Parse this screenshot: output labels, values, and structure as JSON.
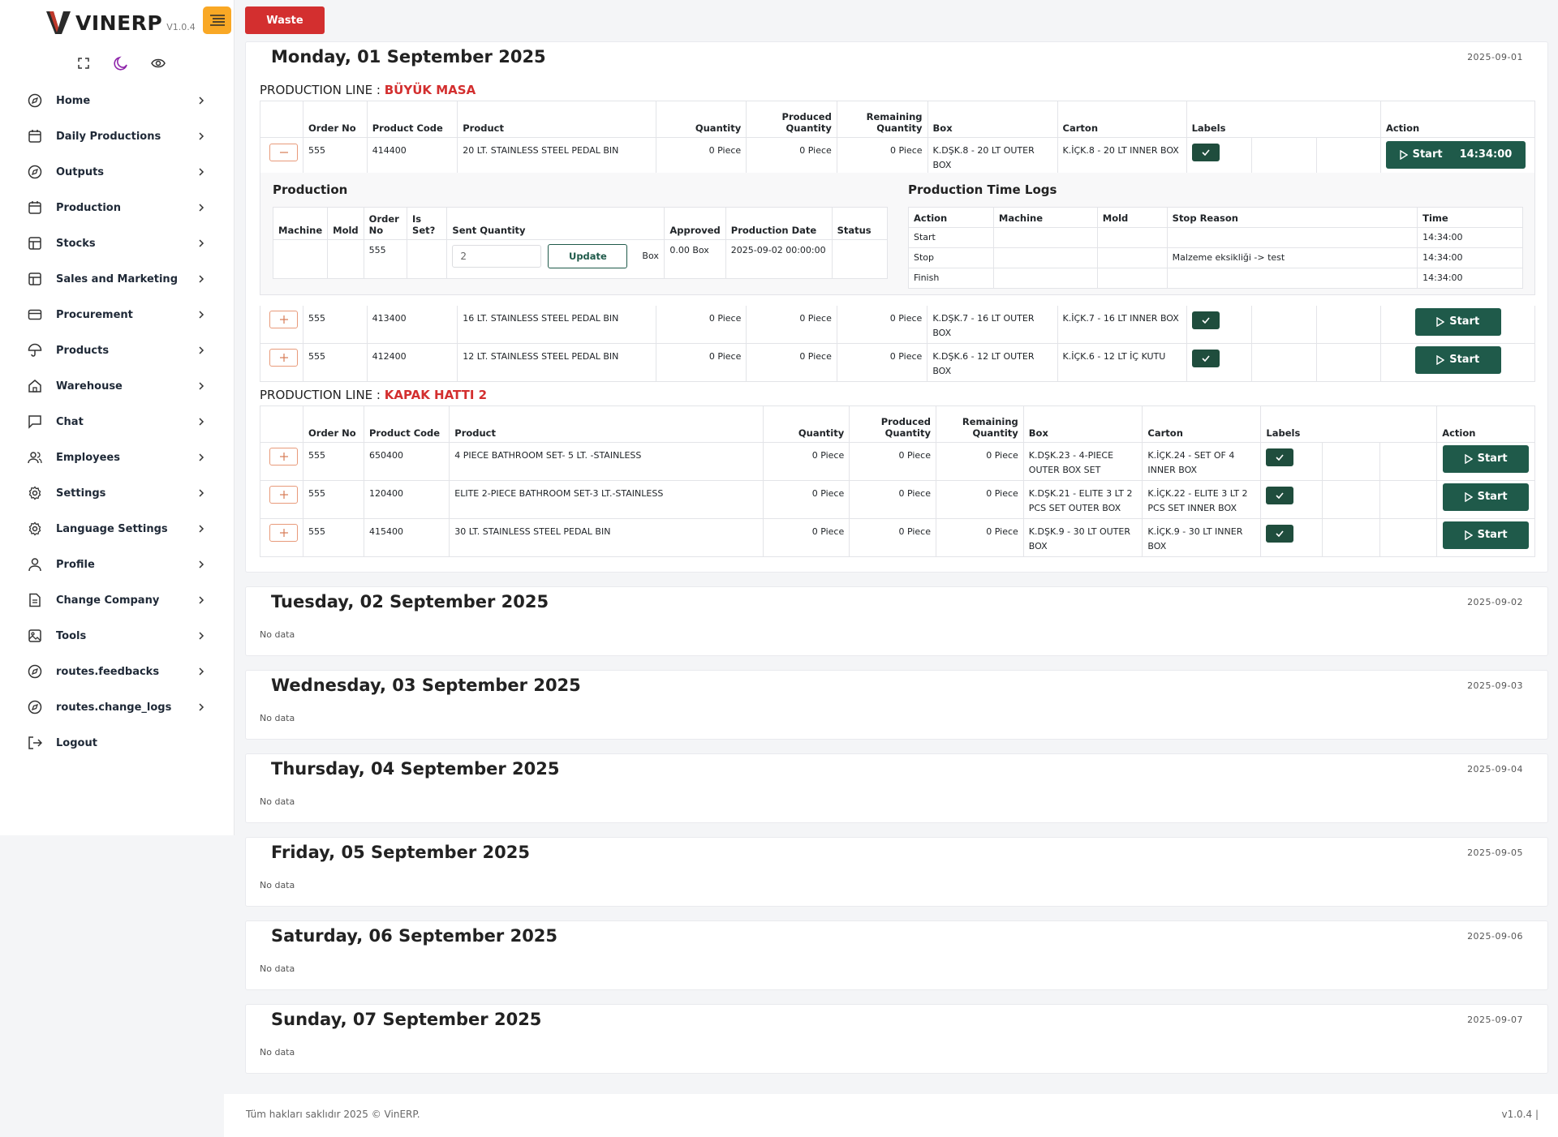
{
  "app": {
    "name": "VINERP",
    "version": "V1.0.4"
  },
  "sidebar": {
    "items": [
      {
        "label": "Home",
        "icon": "compass-icon",
        "chevron": true
      },
      {
        "label": "Daily Productions",
        "icon": "calendar-icon",
        "chevron": true
      },
      {
        "label": "Outputs",
        "icon": "compass-icon",
        "chevron": true
      },
      {
        "label": "Production",
        "icon": "calendar-icon",
        "chevron": true
      },
      {
        "label": "Stocks",
        "icon": "table-icon",
        "chevron": true
      },
      {
        "label": "Sales and Marketing",
        "icon": "table-icon",
        "chevron": true
      },
      {
        "label": "Procurement",
        "icon": "card-icon",
        "chevron": true
      },
      {
        "label": "Products",
        "icon": "umbrella-icon",
        "chevron": true
      },
      {
        "label": "Warehouse",
        "icon": "home-icon",
        "chevron": true
      },
      {
        "label": "Chat",
        "icon": "chat-icon",
        "chevron": true
      },
      {
        "label": "Employees",
        "icon": "users-icon",
        "chevron": true
      },
      {
        "label": "Settings",
        "icon": "gear-icon",
        "chevron": true
      },
      {
        "label": "Language Settings",
        "icon": "gear-icon",
        "chevron": true
      },
      {
        "label": "Profile",
        "icon": "user-icon",
        "chevron": true
      },
      {
        "label": "Change Company",
        "icon": "document-icon",
        "chevron": true
      },
      {
        "label": "Tools",
        "icon": "image-icon",
        "chevron": true
      },
      {
        "label": "routes.feedbacks",
        "icon": "compass-icon",
        "chevron": true
      },
      {
        "label": "routes.change_logs",
        "icon": "compass-icon",
        "chevron": true
      },
      {
        "label": "Logout",
        "icon": "logout-icon",
        "chevron": false
      }
    ]
  },
  "toolbar": {
    "waste_label": "Waste"
  },
  "days": [
    {
      "title": "Monday, 01 September 2025",
      "date": "2025-09-01"
    },
    {
      "title": "Tuesday, 02 September 2025",
      "date": "2025-09-02",
      "nodata": "No data"
    },
    {
      "title": "Wednesday, 03 September 2025",
      "date": "2025-09-03",
      "nodata": "No data"
    },
    {
      "title": "Thursday, 04 September 2025",
      "date": "2025-09-04",
      "nodata": "No data"
    },
    {
      "title": "Friday, 05 September 2025",
      "date": "2025-09-05",
      "nodata": "No data"
    },
    {
      "title": "Saturday, 06 September 2025",
      "date": "2025-09-06",
      "nodata": "No data"
    },
    {
      "title": "Sunday, 07 September 2025",
      "date": "2025-09-07",
      "nodata": "No data"
    }
  ],
  "line_prefix": "PRODUCTION LINE : ",
  "columns": {
    "order_no": "Order No",
    "product_code": "Product Code",
    "product": "Product",
    "quantity": "Quantity",
    "produced_1": "Produced",
    "produced_2": "Quantity",
    "remaining_1": "Remaining",
    "remaining_2": "Quantity",
    "box": "Box",
    "carton": "Carton",
    "labels": "Labels",
    "action": "Action"
  },
  "lines": [
    {
      "name": "BÜYÜK MASA",
      "rows": [
        {
          "order_no": "555",
          "code": "414400",
          "product": "20 LT. STAINLESS STEEL PEDAL BIN",
          "qty": "0 Piece",
          "produced": "0 Piece",
          "remaining": "0 Piece",
          "box": "K.DŞK.8 - 20 LT OUTER BOX",
          "carton": "K.İÇK.8 - 20 LT INNER BOX",
          "action": "Start",
          "time": "14:34:00",
          "expanded": true
        },
        {
          "order_no": "555",
          "code": "413400",
          "product": "16 LT. STAINLESS STEEL PEDAL BIN",
          "qty": "0 Piece",
          "produced": "0 Piece",
          "remaining": "0 Piece",
          "box": "K.DŞK.7 - 16 LT OUTER BOX",
          "carton": "K.İÇK.7 - 16 LT INNER BOX",
          "action": "Start"
        },
        {
          "order_no": "555",
          "code": "412400",
          "product": "12 LT. STAINLESS STEEL PEDAL BIN",
          "qty": "0 Piece",
          "produced": "0 Piece",
          "remaining": "0 Piece",
          "box": "K.DŞK.6 - 12 LT OUTER BOX",
          "carton": "K.İÇK.6 - 12 LT İÇ KUTU",
          "action": "Start"
        }
      ]
    },
    {
      "name": "KAPAK HATTI 2",
      "rows": [
        {
          "order_no": "555",
          "code": "650400",
          "product": "4 PIECE BATHROOM SET- 5 LT. -STAINLESS",
          "qty": "0 Piece",
          "produced": "0 Piece",
          "remaining": "0 Piece",
          "box": "K.DŞK.23 - 4-PIECE OUTER BOX SET",
          "carton": "K.İÇK.24 - SET OF 4 INNER BOX",
          "action": "Start"
        },
        {
          "order_no": "555",
          "code": "120400",
          "product": "ELITE 2-PIECE BATHROOM SET-3 LT.-STAINLESS",
          "qty": "0 Piece",
          "produced": "0 Piece",
          "remaining": "0 Piece",
          "box": "K.DŞK.21 - ELITE 3 LT 2 PCS SET OUTER BOX",
          "carton": "K.İÇK.22 - ELITE 3 LT 2 PCS SET INNER BOX",
          "action": "Start"
        },
        {
          "order_no": "555",
          "code": "415400",
          "product": "30 LT. STAINLESS STEEL PEDAL BIN",
          "qty": "0 Piece",
          "produced": "0 Piece",
          "remaining": "0 Piece",
          "box": "K.DŞK.9 - 30 LT OUTER BOX",
          "carton": "K.İÇK.9 - 30 LT INNER BOX",
          "action": "Start"
        }
      ]
    }
  ],
  "production_detail": {
    "title": "Production",
    "columns": {
      "machine": "Machine",
      "mold": "Mold",
      "order_1": "Order",
      "order_2": "No",
      "isset_1": "Is",
      "isset_2": "Set?",
      "sent": "Sent Quantity",
      "approved": "Approved",
      "prod_date": "Production Date",
      "status": "Status"
    },
    "row": {
      "order_no": "555",
      "sent_value": "2",
      "update_label": "Update",
      "unit": "Box",
      "approved": "0.00 Box",
      "prod_date": "2025-09-02 00:00:00"
    }
  },
  "time_logs": {
    "title": "Production Time Logs",
    "columns": {
      "action": "Action",
      "machine": "Machine",
      "mold": "Mold",
      "stop_reason": "Stop Reason",
      "time": "Time"
    },
    "rows": [
      {
        "action": "Start",
        "stop_reason": "",
        "time": "14:34:00"
      },
      {
        "action": "Stop",
        "stop_reason": "Malzeme eksikliği -> test",
        "time": "14:34:00"
      },
      {
        "action": "Finish",
        "stop_reason": "",
        "time": "14:34:00"
      }
    ]
  },
  "footer": {
    "copyright": "Tüm hakları saklıdır 2025 © VinERP.",
    "version": "v1.0.4 |"
  },
  "colors": {
    "accent_green": "#1f5a4a",
    "danger": "#d32f2f",
    "toggle": "#f9a825"
  }
}
